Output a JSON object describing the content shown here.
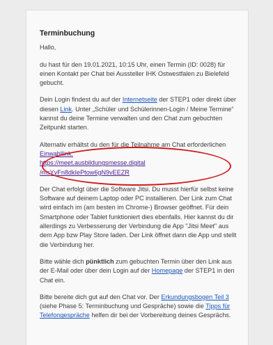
{
  "email": {
    "title": "Terminbuchung",
    "greeting": "Hallo,",
    "p1": "du hast für den 19.01.2021, 10:15 Uhr, einen Termin (ID: 0028) für einen Kontakt per Chat bei Aussteller IHK Ostwestfalen zu Bielefeld gebucht.",
    "p2": {
      "pre": "Dein Login findest du auf der ",
      "link1": "Internetseite",
      "mid1": " der STEP1 oder direkt über diesen ",
      "link2": "Link",
      "post": ". Unter „Schüler und Schülerinnen-Login / Meine Termine“ kannst du deine Termine verwalten und den Chat zum gebuchten Zeitpunkt starten."
    },
    "p3": {
      "pre": "Alternativ erhältst du den für die Teilnahme am Chat erforderlichen ",
      "link_label": "Einwahllink:",
      "url_line1": "https://meet.ausbildungsmesse.digital",
      "url_line2": "/msYyFn8dkIePtow6gN9vEEZR"
    },
    "p4": "Der Chat erfolgt über die Software Jitsi. Du musst hierfür selbst keine Software auf deinem Laptop oder PC installieren. Der Link zum Chat wird einfach im (am besten im Chrome-) Browser geöffnet. Für dein Smartphone oder Tablet funktioniert dies ebenfalls. Hier kannst du dir allerdings zu Verbesserung der Verbindung die App \"Jitsi Meet\" aus dem App bzw Play Store laden. Der Link öffnet dann die App und stellt die Verbindung her.",
    "p5": {
      "pre": "Bitte wähle dich ",
      "bold": "pünktlich",
      "mid": " zum gebuchten Termin über den Link aus der E-Mail oder über dein Login auf der ",
      "link": "Homepage",
      "post": " der STEP1 in den Chat ein."
    },
    "p6": {
      "pre": "Bitte bereite dich gut auf den Chat vor. Der ",
      "link1": "Erkundungsbogen Teil 3",
      "mid": " (siehe Phase 5: Terminbuchung und Gespräche) sowie die ",
      "link2": "Tipps für Telefongespräche",
      "post": " helfen dir bei der Vorbereitung deines Gesprächs."
    }
  },
  "colors": {
    "background": "#ececec",
    "card": "#f9f9f9",
    "link": "#1a56b8",
    "highlight": "#d11a1a"
  }
}
